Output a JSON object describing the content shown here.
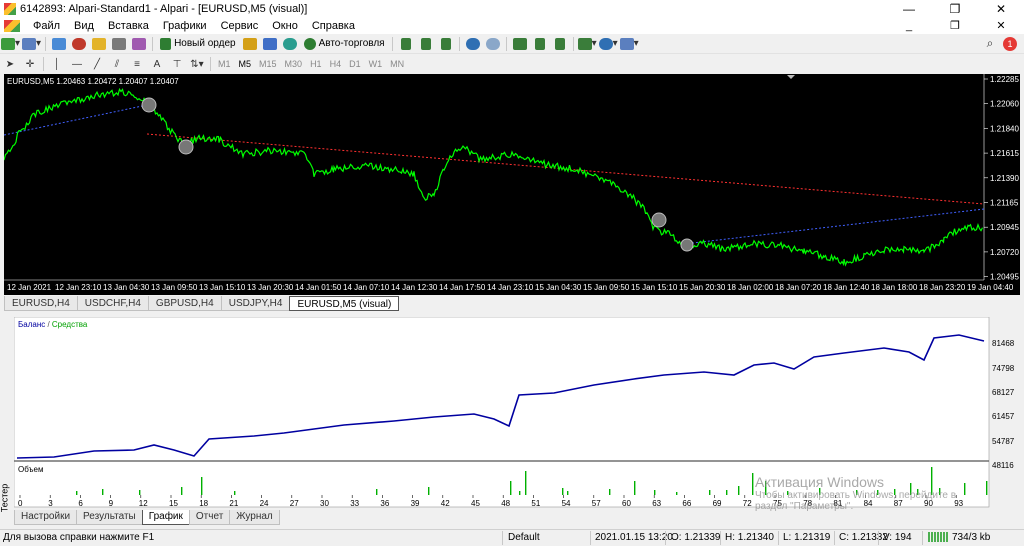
{
  "window": {
    "title": "6142893: Alpari-Standard1 - Alpari - [EURUSD,M5 (visual)]"
  },
  "menu": [
    "Файл",
    "Вид",
    "Вставка",
    "Графики",
    "Сервис",
    "Окно",
    "Справка"
  ],
  "toolbar": {
    "new_order": "Новый ордер",
    "auto_trading": "Авто-торговля",
    "timeframes": [
      "M1",
      "M5",
      "M15",
      "M30",
      "H1",
      "H4",
      "D1",
      "W1",
      "MN"
    ],
    "active_timeframe": "M5",
    "text_tool": "A",
    "alerts_badge": "1"
  },
  "chart": {
    "info": "EURUSD,M5  1.20463 1.20472 1.20407 1.20407",
    "price_labels": [
      "1.22285",
      "1.22060",
      "1.21840",
      "1.21615",
      "1.21390",
      "1.21165",
      "1.20945",
      "1.20720",
      "1.20495"
    ],
    "time_labels": [
      "12 Jan 2021",
      "12 Jan 23:10",
      "13 Jan 04:30",
      "13 Jan 09:50",
      "13 Jan 15:10",
      "13 Jan 20:30",
      "14 Jan 01:50",
      "14 Jan 07:10",
      "14 Jan 12:30",
      "14 Jan 17:50",
      "14 Jan 23:10",
      "15 Jan 04:30",
      "15 Jan 09:50",
      "15 Jan 15:10",
      "15 Jan 20:30",
      "18 Jan 02:00",
      "18 Jan 07:20",
      "18 Jan 12:40",
      "18 Jan 18:00",
      "18 Jan 23:20",
      "19 Jan 04:40"
    ],
    "line_color": "#00ff00",
    "background": "#000000"
  },
  "symbol_tabs": [
    "EURUSD,H4",
    "USDCHF,H4",
    "GBPUSD,H4",
    "USDJPY,H4",
    "EURUSD,M5 (visual)"
  ],
  "tester": {
    "side_label": "Тестер",
    "graph_legend_balance": "Баланс",
    "graph_legend_sep": " / ",
    "graph_legend_equity": "Средства",
    "volume_label": "Объем",
    "balance_color": "#0000a0",
    "equity_color": "#00a000",
    "y_labels": [
      "81468",
      "74798",
      "68127",
      "61457",
      "54787",
      "48116"
    ],
    "x_labels": [
      "0",
      "3",
      "6",
      "9",
      "12",
      "15",
      "18",
      "21",
      "24",
      "27",
      "30",
      "33",
      "36",
      "39",
      "42",
      "45",
      "48",
      "51",
      "54",
      "57",
      "60",
      "63",
      "66",
      "69",
      "72",
      "75",
      "78",
      "81",
      "84",
      "87",
      "90",
      "93"
    ],
    "tabs": [
      "Настройки",
      "Результаты",
      "График",
      "Отчет",
      "Журнал"
    ],
    "active_tab": "График"
  },
  "watermark": {
    "title": "Активация Windows",
    "line1": "Чтобы активировать Windows, перейдите в",
    "line2": "раздел \"Параметры\"."
  },
  "status": {
    "help": "Для вызова справки нажмите F1",
    "profile": "Default",
    "datetime": "2021.01.15 13:20",
    "open": "O: 1.21339",
    "high": "H: 1.21340",
    "low": "L: 1.21319",
    "close": "C: 1.21332",
    "volume": "V: 194",
    "traffic": "734/3 kb"
  }
}
